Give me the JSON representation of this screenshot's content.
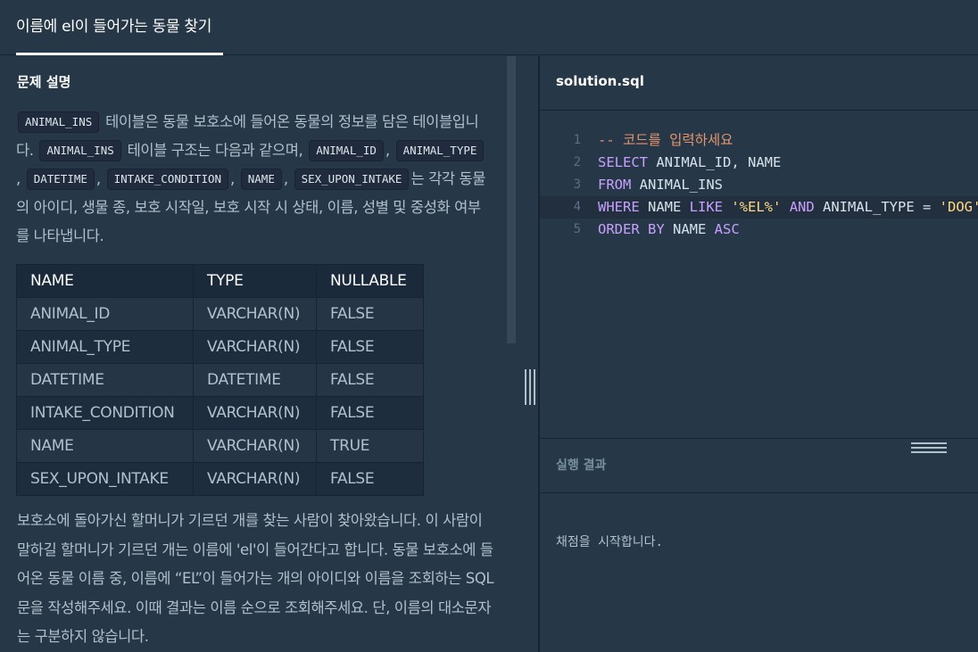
{
  "tab": {
    "title": "이름에 el이 들어가는 동물 찾기"
  },
  "problem": {
    "section_title": "문제 설명",
    "desc": {
      "t_animal_ins": "ANIMAL_INS",
      "p1": " 테이블은 동물 보호소에 들어온 동물의 정보를 담은 테이블입니다. ",
      "t_animal_ins2": "ANIMAL_INS",
      "p2": " 테이블 구조는 다음과 같으며, ",
      "c_animal_id": "ANIMAL_ID",
      "c_animal_type": "ANIMAL_TYPE",
      "c_datetime": "DATETIME",
      "c_intake_condition": "INTAKE_CONDITION",
      "c_name": "NAME",
      "c_sex_upon_intake": "SEX_UPON_INTAKE",
      "p3": "는 각각 동물의 아이디, 생물 종, 보호 시작일, 보호 시작 시 상태, 이름, 성별 및 중성화 여부를 나타냅니다."
    },
    "table": {
      "headers": [
        "NAME",
        "TYPE",
        "NULLABLE"
      ],
      "rows": [
        [
          "ANIMAL_ID",
          "VARCHAR(N)",
          "FALSE"
        ],
        [
          "ANIMAL_TYPE",
          "VARCHAR(N)",
          "FALSE"
        ],
        [
          "DATETIME",
          "DATETIME",
          "FALSE"
        ],
        [
          "INTAKE_CONDITION",
          "VARCHAR(N)",
          "FALSE"
        ],
        [
          "NAME",
          "VARCHAR(N)",
          "TRUE"
        ],
        [
          "SEX_UPON_INTAKE",
          "VARCHAR(N)",
          "FALSE"
        ]
      ]
    },
    "desc2": "보호소에 돌아가신 할머니가 기르던 개를 찾는 사람이 찾아왔습니다. 이 사람이 말하길 할머니가 기르던 개는 이름에 'el'이 들어간다고 합니다. 동물 보호소에 들어온 동물 이름 중, 이름에 “EL”이 들어가는 개의 아이디와 이름을 조회하는 SQL문을 작성해주세요. 이때 결과는 이름 순으로 조회해주세요. 단, 이름의 대소문자는 구분하지 않습니다."
  },
  "editor": {
    "filename": "solution.sql",
    "lines": [
      {
        "n": "1",
        "tokens": [
          [
            "cm",
            "-- 코드를 입력하세요"
          ]
        ]
      },
      {
        "n": "2",
        "tokens": [
          [
            "kw",
            "SELECT"
          ],
          [
            "op",
            " ANIMAL_ID, NAME"
          ]
        ]
      },
      {
        "n": "3",
        "tokens": [
          [
            "kw",
            "FROM"
          ],
          [
            "op",
            " ANIMAL_INS"
          ]
        ]
      },
      {
        "n": "4",
        "tokens": [
          [
            "kw",
            "WHERE"
          ],
          [
            "op",
            " NAME "
          ],
          [
            "kw",
            "LIKE"
          ],
          [
            "op",
            " "
          ],
          [
            "str",
            "'%EL%'"
          ],
          [
            "op",
            " "
          ],
          [
            "kw",
            "AND"
          ],
          [
            "op",
            " ANIMAL_TYPE = "
          ],
          [
            "str",
            "'DOG'"
          ]
        ]
      },
      {
        "n": "5",
        "tokens": [
          [
            "kw",
            "ORDER BY"
          ],
          [
            "op",
            " NAME "
          ],
          [
            "kw",
            "ASC"
          ]
        ]
      }
    ]
  },
  "result": {
    "title": "실행 결과",
    "text": "채점을 시작합니다."
  }
}
